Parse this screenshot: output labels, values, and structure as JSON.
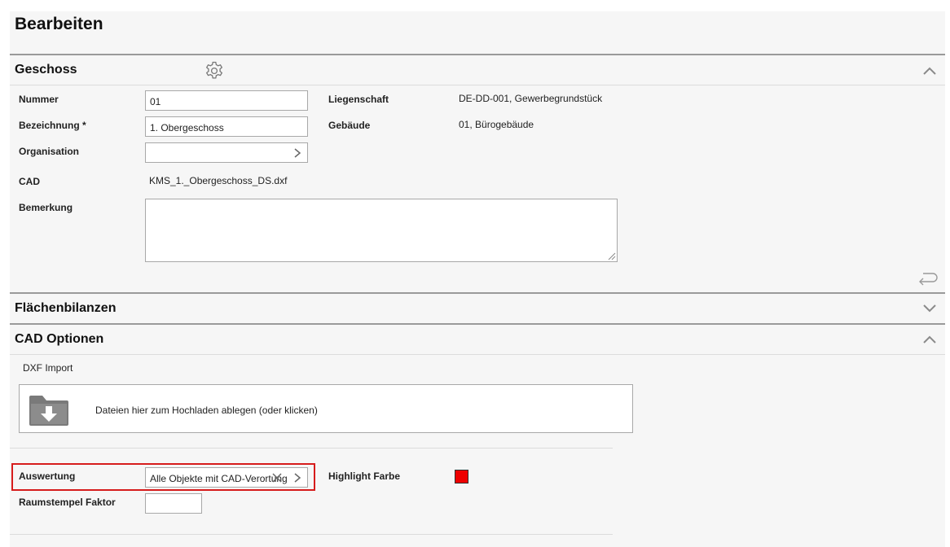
{
  "page": {
    "title": "Bearbeiten"
  },
  "sections": {
    "geschoss": {
      "title": "Geschoss",
      "expanded": true,
      "icon": "gear-icon"
    },
    "flaechenbilanzen": {
      "title": "Flächenbilanzen",
      "expanded": false
    },
    "cad_optionen": {
      "title": "CAD Optionen",
      "expanded": true
    }
  },
  "form": {
    "nummer": {
      "label": "Nummer",
      "value": "01"
    },
    "bezeichnung": {
      "label": "Bezeichnung *",
      "value": "1. Obergeschoss"
    },
    "organisation": {
      "label": "Organisation",
      "value": ""
    },
    "cad": {
      "label": "CAD",
      "value": "KMS_1._Obergeschoss_DS.dxf"
    },
    "bemerkung": {
      "label": "Bemerkung",
      "value": ""
    },
    "liegenschaft": {
      "label": "Liegenschaft",
      "value": "DE-DD-001, Gewerbegrundstück"
    },
    "gebaeude": {
      "label": "Gebäude",
      "value": "01, Bürogebäude"
    }
  },
  "cad_options": {
    "dxf_import_label": "DXF Import",
    "dropzone_text": "Dateien hier zum Hochladen ablegen (oder klicken)",
    "auswertung": {
      "label": "Auswertung",
      "value": "Alle Objekte mit CAD-Verortung"
    },
    "highlight_farbe": {
      "label": "Highlight Farbe",
      "color": "#ee0000"
    },
    "raumstempel_faktor": {
      "label": "Raumstempel Faktor",
      "value": ""
    }
  },
  "colors": {
    "highlight_border": "#d61c1c",
    "divider": "#9a9a9a"
  }
}
